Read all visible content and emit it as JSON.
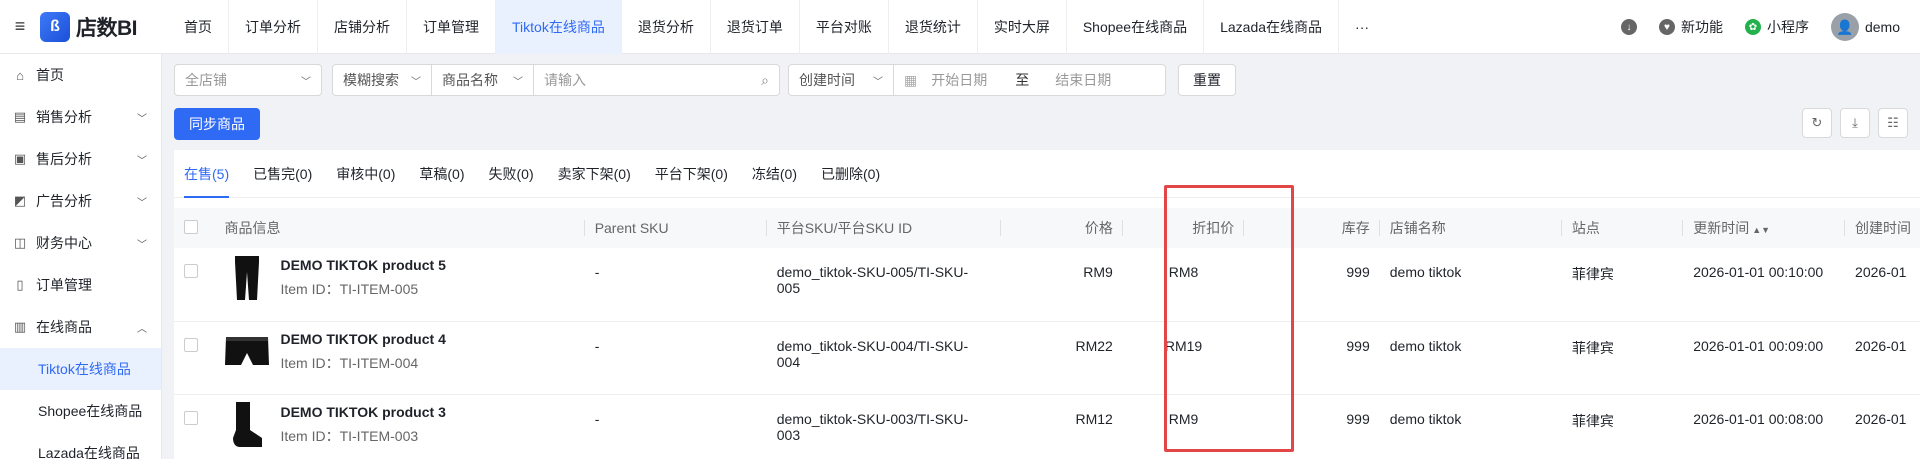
{
  "app": {
    "logo_text": "店数BI"
  },
  "nav_tabs": [
    {
      "label": "首页"
    },
    {
      "label": "订单分析"
    },
    {
      "label": "店铺分析"
    },
    {
      "label": "订单管理"
    },
    {
      "label": "Tiktok在线商品",
      "active": true
    },
    {
      "label": "退货分析"
    },
    {
      "label": "退货订单"
    },
    {
      "label": "平台对账"
    },
    {
      "label": "退货统计"
    },
    {
      "label": "实时大屏"
    },
    {
      "label": "Shopee在线商品"
    },
    {
      "label": "Lazada在线商品"
    },
    {
      "label": "···"
    }
  ],
  "topright": {
    "new_features": "新功能",
    "mini_program": "小程序",
    "user": "demo"
  },
  "sidebar": {
    "items": [
      {
        "label": "首页",
        "icon": "home-icon"
      },
      {
        "label": "销售分析",
        "icon": "sales-icon",
        "expandable": true
      },
      {
        "label": "售后分析",
        "icon": "aftersales-icon",
        "expandable": true
      },
      {
        "label": "广告分析",
        "icon": "ad-icon",
        "expandable": true
      },
      {
        "label": "财务中心",
        "icon": "finance-icon",
        "expandable": true
      },
      {
        "label": "订单管理",
        "icon": "order-icon"
      },
      {
        "label": "在线商品",
        "icon": "product-icon",
        "expandable": true,
        "expanded": true
      }
    ],
    "sub_items": [
      {
        "label": "Tiktok在线商品",
        "active": true
      },
      {
        "label": "Shopee在线商品"
      },
      {
        "label": "Lazada在线商品"
      }
    ]
  },
  "filters": {
    "shop_placeholder": "全店铺",
    "search_mode": "模糊搜索",
    "field": "商品名称",
    "search_placeholder": "请输入",
    "time_field": "创建时间",
    "start_placeholder": "开始日期",
    "range_sep": "至",
    "end_placeholder": "结束日期",
    "reset": "重置"
  },
  "sync_button": "同步商品",
  "status_tabs": [
    {
      "label": "在售(5)",
      "active": true
    },
    {
      "label": "已售完(0)"
    },
    {
      "label": "审核中(0)"
    },
    {
      "label": "草稿(0)"
    },
    {
      "label": "失败(0)"
    },
    {
      "label": "卖家下架(0)"
    },
    {
      "label": "平台下架(0)"
    },
    {
      "label": "冻结(0)"
    },
    {
      "label": "已删除(0)"
    }
  ],
  "table": {
    "headers": {
      "product": "商品信息",
      "parent_sku": "Parent SKU",
      "platform_sku": "平台SKU/平台SKU ID",
      "price": "价格",
      "discount": "折扣价",
      "stock": "库存",
      "shop": "店铺名称",
      "site": "站点",
      "updated": "更新时间",
      "created": "创建时间"
    },
    "rows": [
      {
        "name": "DEMO TIKTOK product 5",
        "item_id": "Item ID：TI-ITEM-005",
        "parent_sku": "-",
        "platform_sku": "demo_tiktok-SKU-005/TI-SKU-005",
        "price": "RM9",
        "discount": "RM8",
        "stock": "999",
        "shop": "demo tiktok",
        "site": "菲律宾",
        "updated": "2026-01-01 00:10:00",
        "created": "2026-01",
        "thumb": "pants-icon"
      },
      {
        "name": "DEMO TIKTOK product 4",
        "item_id": "Item ID：TI-ITEM-004",
        "parent_sku": "-",
        "platform_sku": "demo_tiktok-SKU-004/TI-SKU-004",
        "price": "RM22",
        "discount": "RM19",
        "stock": "999",
        "shop": "demo tiktok",
        "site": "菲律宾",
        "updated": "2026-01-01 00:09:00",
        "created": "2026-01",
        "thumb": "shorts-icon"
      },
      {
        "name": "DEMO TIKTOK product 3",
        "item_id": "Item ID：TI-ITEM-003",
        "parent_sku": "-",
        "platform_sku": "demo_tiktok-SKU-003/TI-SKU-003",
        "price": "RM12",
        "discount": "RM9",
        "stock": "999",
        "shop": "demo tiktok",
        "site": "菲律宾",
        "updated": "2026-01-01 00:08:00",
        "created": "2026-01",
        "thumb": "sock-icon"
      }
    ]
  },
  "colors": {
    "accent": "#2f6af5",
    "highlight": "#e34646"
  }
}
